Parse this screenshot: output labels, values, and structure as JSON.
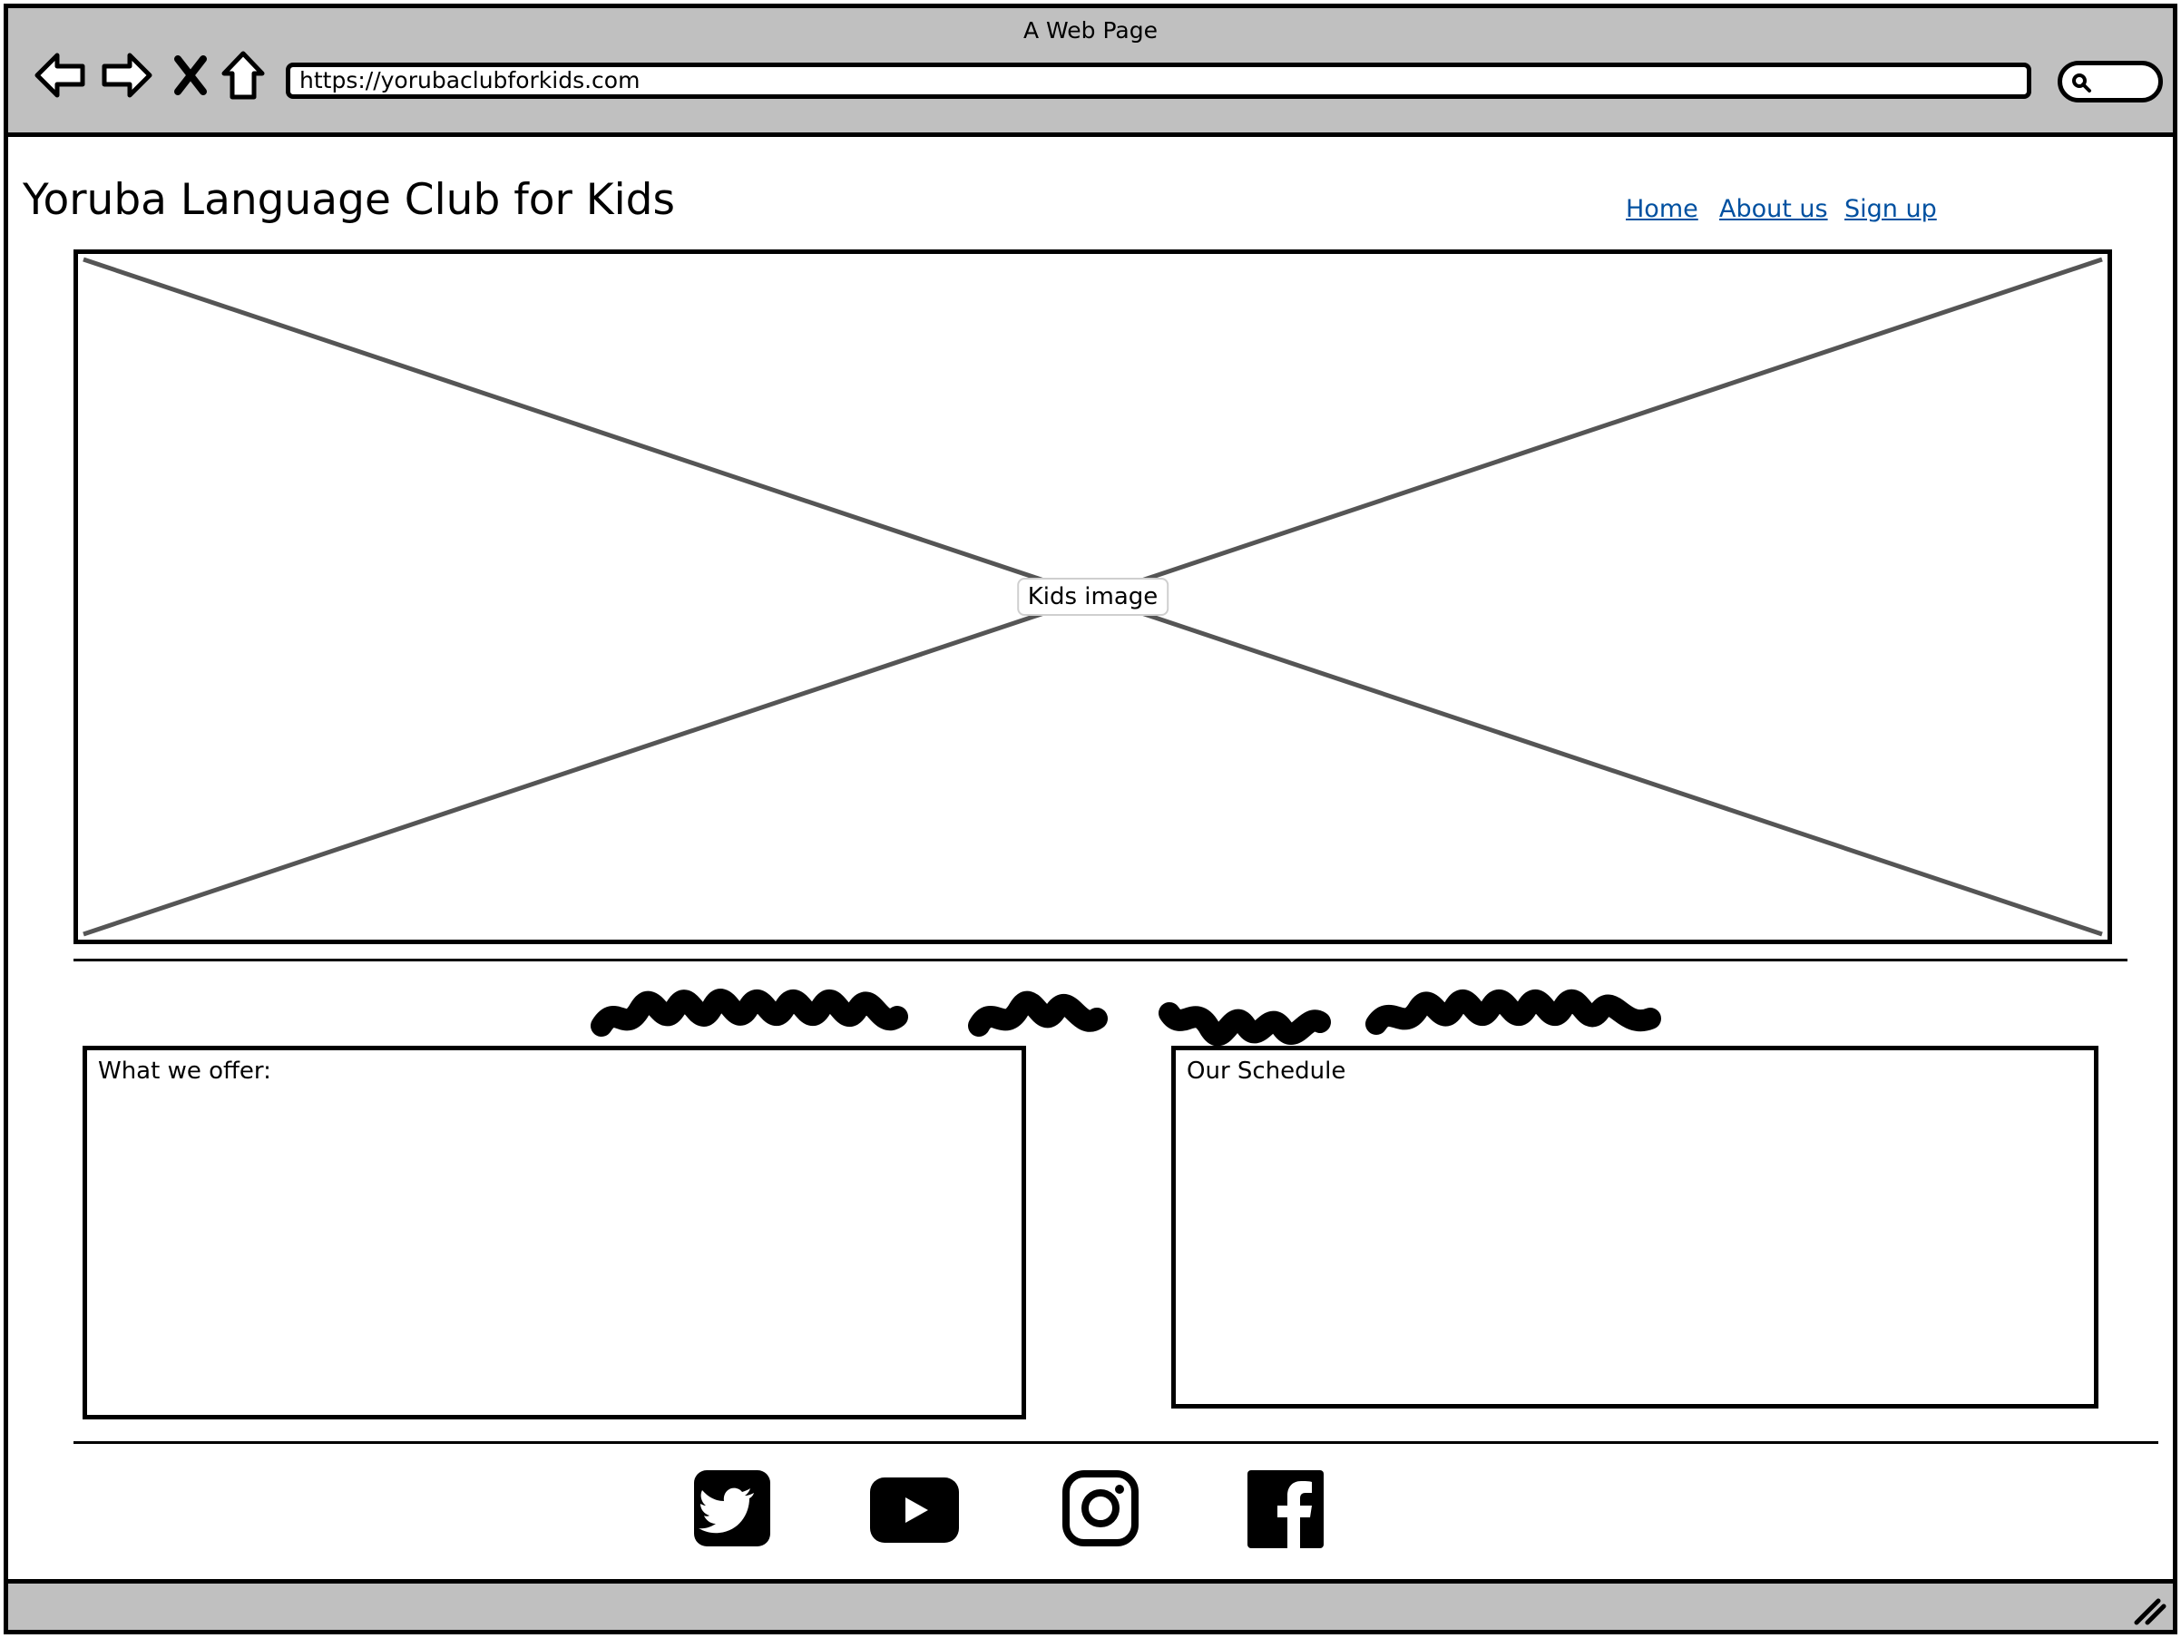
{
  "browser": {
    "window_title": "A Web Page",
    "url": "https://yorubaclubforkids.com",
    "nav_icons": [
      "back-arrow-icon",
      "forward-arrow-icon",
      "close-icon",
      "home-icon"
    ],
    "search_icon": "search-icon"
  },
  "site": {
    "title": "Yoruba Language Club for Kids",
    "nav": [
      {
        "label": "Home"
      },
      {
        "label": "About us"
      },
      {
        "label": "Sign up"
      }
    ]
  },
  "hero": {
    "caption": "Kids image"
  },
  "sections": {
    "offer_label": "What we offer:",
    "schedule_label": "Our Schedule"
  },
  "footer": {
    "social": [
      {
        "name": "twitter-icon"
      },
      {
        "name": "youtube-icon"
      },
      {
        "name": "instagram-icon"
      },
      {
        "name": "facebook-icon"
      }
    ]
  },
  "colors": {
    "chrome": "#c0c0c0",
    "link": "#0050a0",
    "placeholder_line": "#555555"
  }
}
